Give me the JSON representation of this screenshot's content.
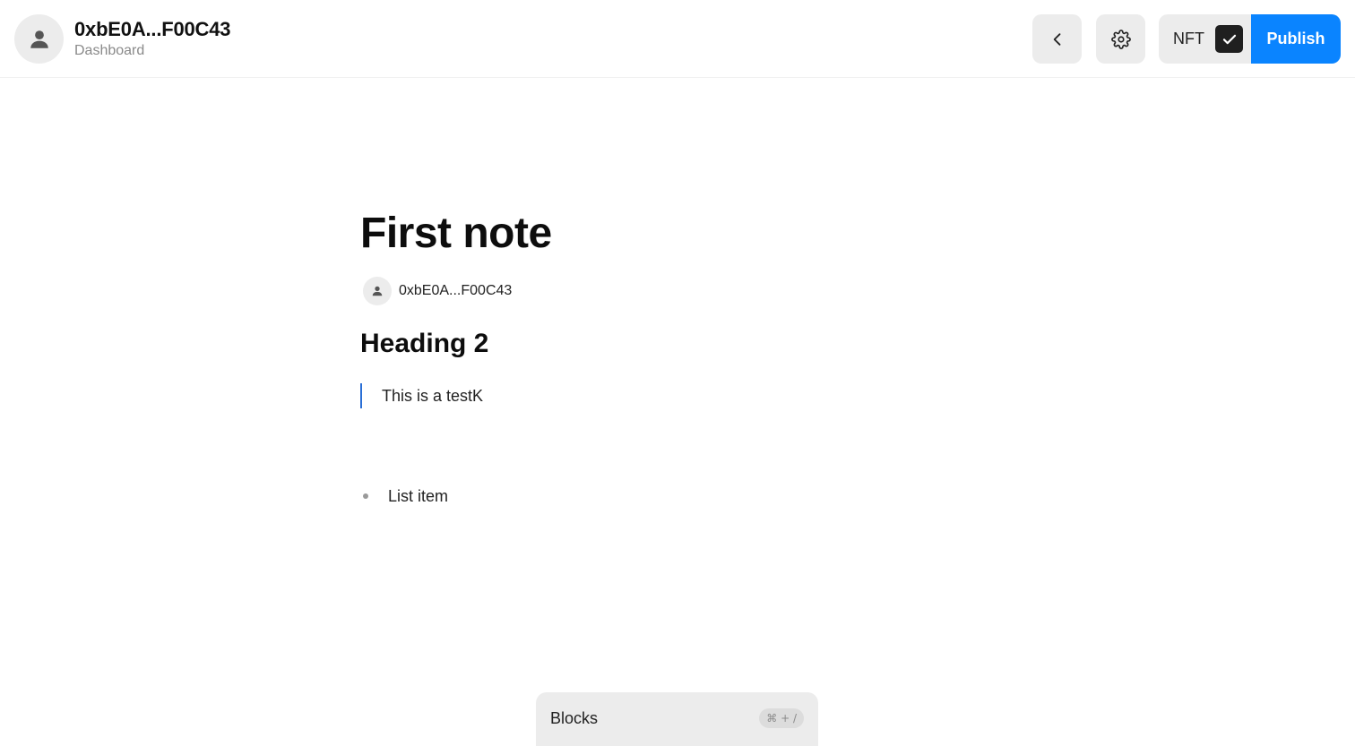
{
  "header": {
    "user_name": "0xbE0A...F00C43",
    "user_subtitle": "Dashboard",
    "avatar_icon": "user-icon",
    "back_icon": "chevron-left-icon",
    "settings_icon": "gear-icon",
    "nft_label": "NFT",
    "nft_checked": true,
    "publish_label": "Publish",
    "publish_color": "#0a84ff"
  },
  "note": {
    "title": "First note",
    "author": "0xbE0A...F00C43",
    "heading2": "Heading 2",
    "quote": "This is a testK",
    "quote_border_color": "#2a6fd6",
    "list_items": [
      "List item"
    ]
  },
  "blocks_panel": {
    "label": "Blocks",
    "shortcut": "⌘ + /"
  }
}
